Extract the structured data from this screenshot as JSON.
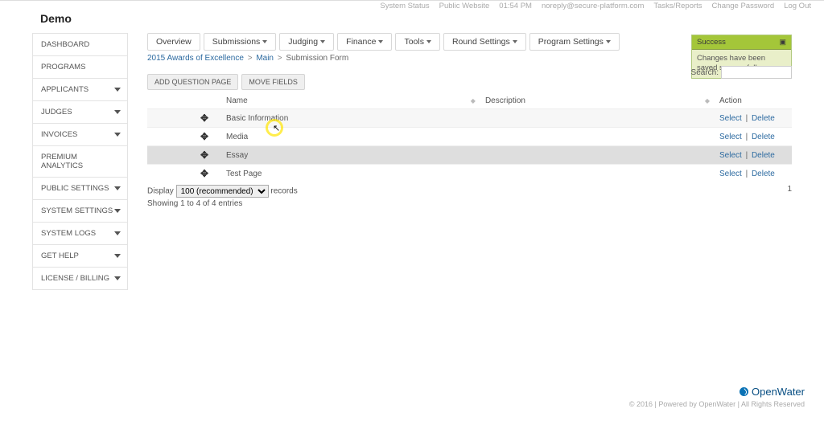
{
  "header_links": [
    "System Status",
    "Public Website",
    "01:54 PM",
    "noreply@secure-platform.com",
    "Tasks/Reports",
    "Change Password",
    "Log Out"
  ],
  "title": "Demo",
  "sidebar": [
    {
      "label": "DASHBOARD",
      "caret": false
    },
    {
      "label": "PROGRAMS",
      "caret": false
    },
    {
      "label": "APPLICANTS",
      "caret": true
    },
    {
      "label": "JUDGES",
      "caret": true
    },
    {
      "label": "INVOICES",
      "caret": true
    },
    {
      "label": "PREMIUM ANALYTICS",
      "caret": false
    },
    {
      "label": "PUBLIC SETTINGS",
      "caret": true
    },
    {
      "label": "SYSTEM SETTINGS",
      "caret": true
    },
    {
      "label": "SYSTEM LOGS",
      "caret": true
    },
    {
      "label": "GET HELP",
      "caret": true
    },
    {
      "label": "LICENSE / BILLING",
      "caret": true
    }
  ],
  "notif": {
    "head": "Success",
    "body": "Changes have been saved successfully."
  },
  "tabs": [
    {
      "label": "Overview",
      "caret": false
    },
    {
      "label": "Submissions",
      "caret": true
    },
    {
      "label": "Judging",
      "caret": true
    },
    {
      "label": "Finance",
      "caret": true
    },
    {
      "label": "Tools",
      "caret": true
    },
    {
      "label": "Round Settings",
      "caret": true
    },
    {
      "label": "Program Settings",
      "caret": true
    }
  ],
  "breadcrumb": {
    "a": "2015 Awards of Excellence",
    "b": "Main",
    "c": "Submission Form"
  },
  "buttons": {
    "add": "ADD QUESTION PAGE",
    "move": "MOVE FIELDS"
  },
  "search": {
    "label": "Search:",
    "value": ""
  },
  "columns": {
    "name": "Name",
    "desc": "Description",
    "action": "Action"
  },
  "rows": [
    {
      "name": "Basic Information",
      "desc": "",
      "zebra": true,
      "active": false
    },
    {
      "name": "Media",
      "desc": "",
      "zebra": false,
      "active": false
    },
    {
      "name": "Essay",
      "desc": "",
      "zebra": true,
      "active": true
    },
    {
      "name": "Test Page",
      "desc": "",
      "zebra": false,
      "active": false
    }
  ],
  "links": {
    "select": "Select",
    "delete": "Delete",
    "sep": "|"
  },
  "display": {
    "pre": "Display",
    "value": "100 (recommended)",
    "post": "records"
  },
  "showing": "Showing 1 to 4 of 4 entries",
  "page": "1",
  "footer": {
    "brand": "OpenWater",
    "sub": "© 2016 | Powered by OpenWater | All Rights Reserved"
  }
}
